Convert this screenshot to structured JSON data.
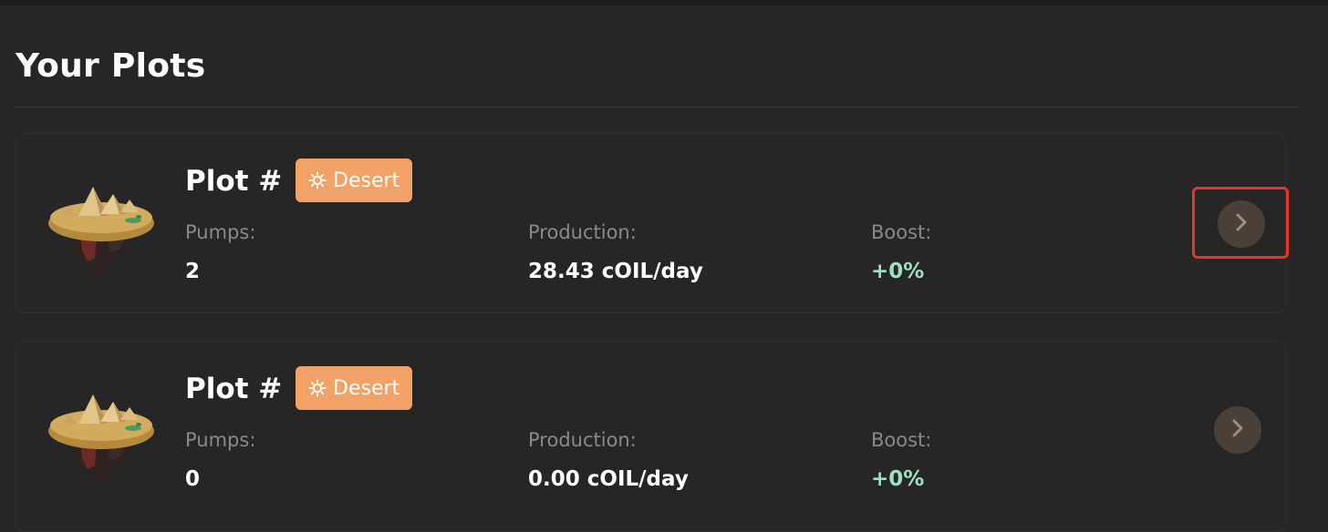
{
  "page": {
    "title": "Your Plots"
  },
  "plots": [
    {
      "name": "Plot #",
      "biome": {
        "label": "Desert",
        "icon": "sun-icon",
        "color": "#f2a266"
      },
      "pumps_label": "Pumps:",
      "pumps": "2",
      "production_label": "Production:",
      "production": "28.43 cOIL/day",
      "boost_label": "Boost:",
      "boost": "+0%",
      "action_icon": "chevron-right-icon",
      "highlighted": true
    },
    {
      "name": "Plot #",
      "biome": {
        "label": "Desert",
        "icon": "sun-icon",
        "color": "#f2a266"
      },
      "pumps_label": "Pumps:",
      "pumps": "0",
      "production_label": "Production:",
      "production": "0.00 cOIL/day",
      "boost_label": "Boost:",
      "boost": "+0%",
      "action_icon": "chevron-right-icon",
      "highlighted": false
    }
  ],
  "colors": {
    "background": "#262626",
    "badge": "#f2a266",
    "boost": "#9fe0c2",
    "highlight": "#e8352a"
  }
}
